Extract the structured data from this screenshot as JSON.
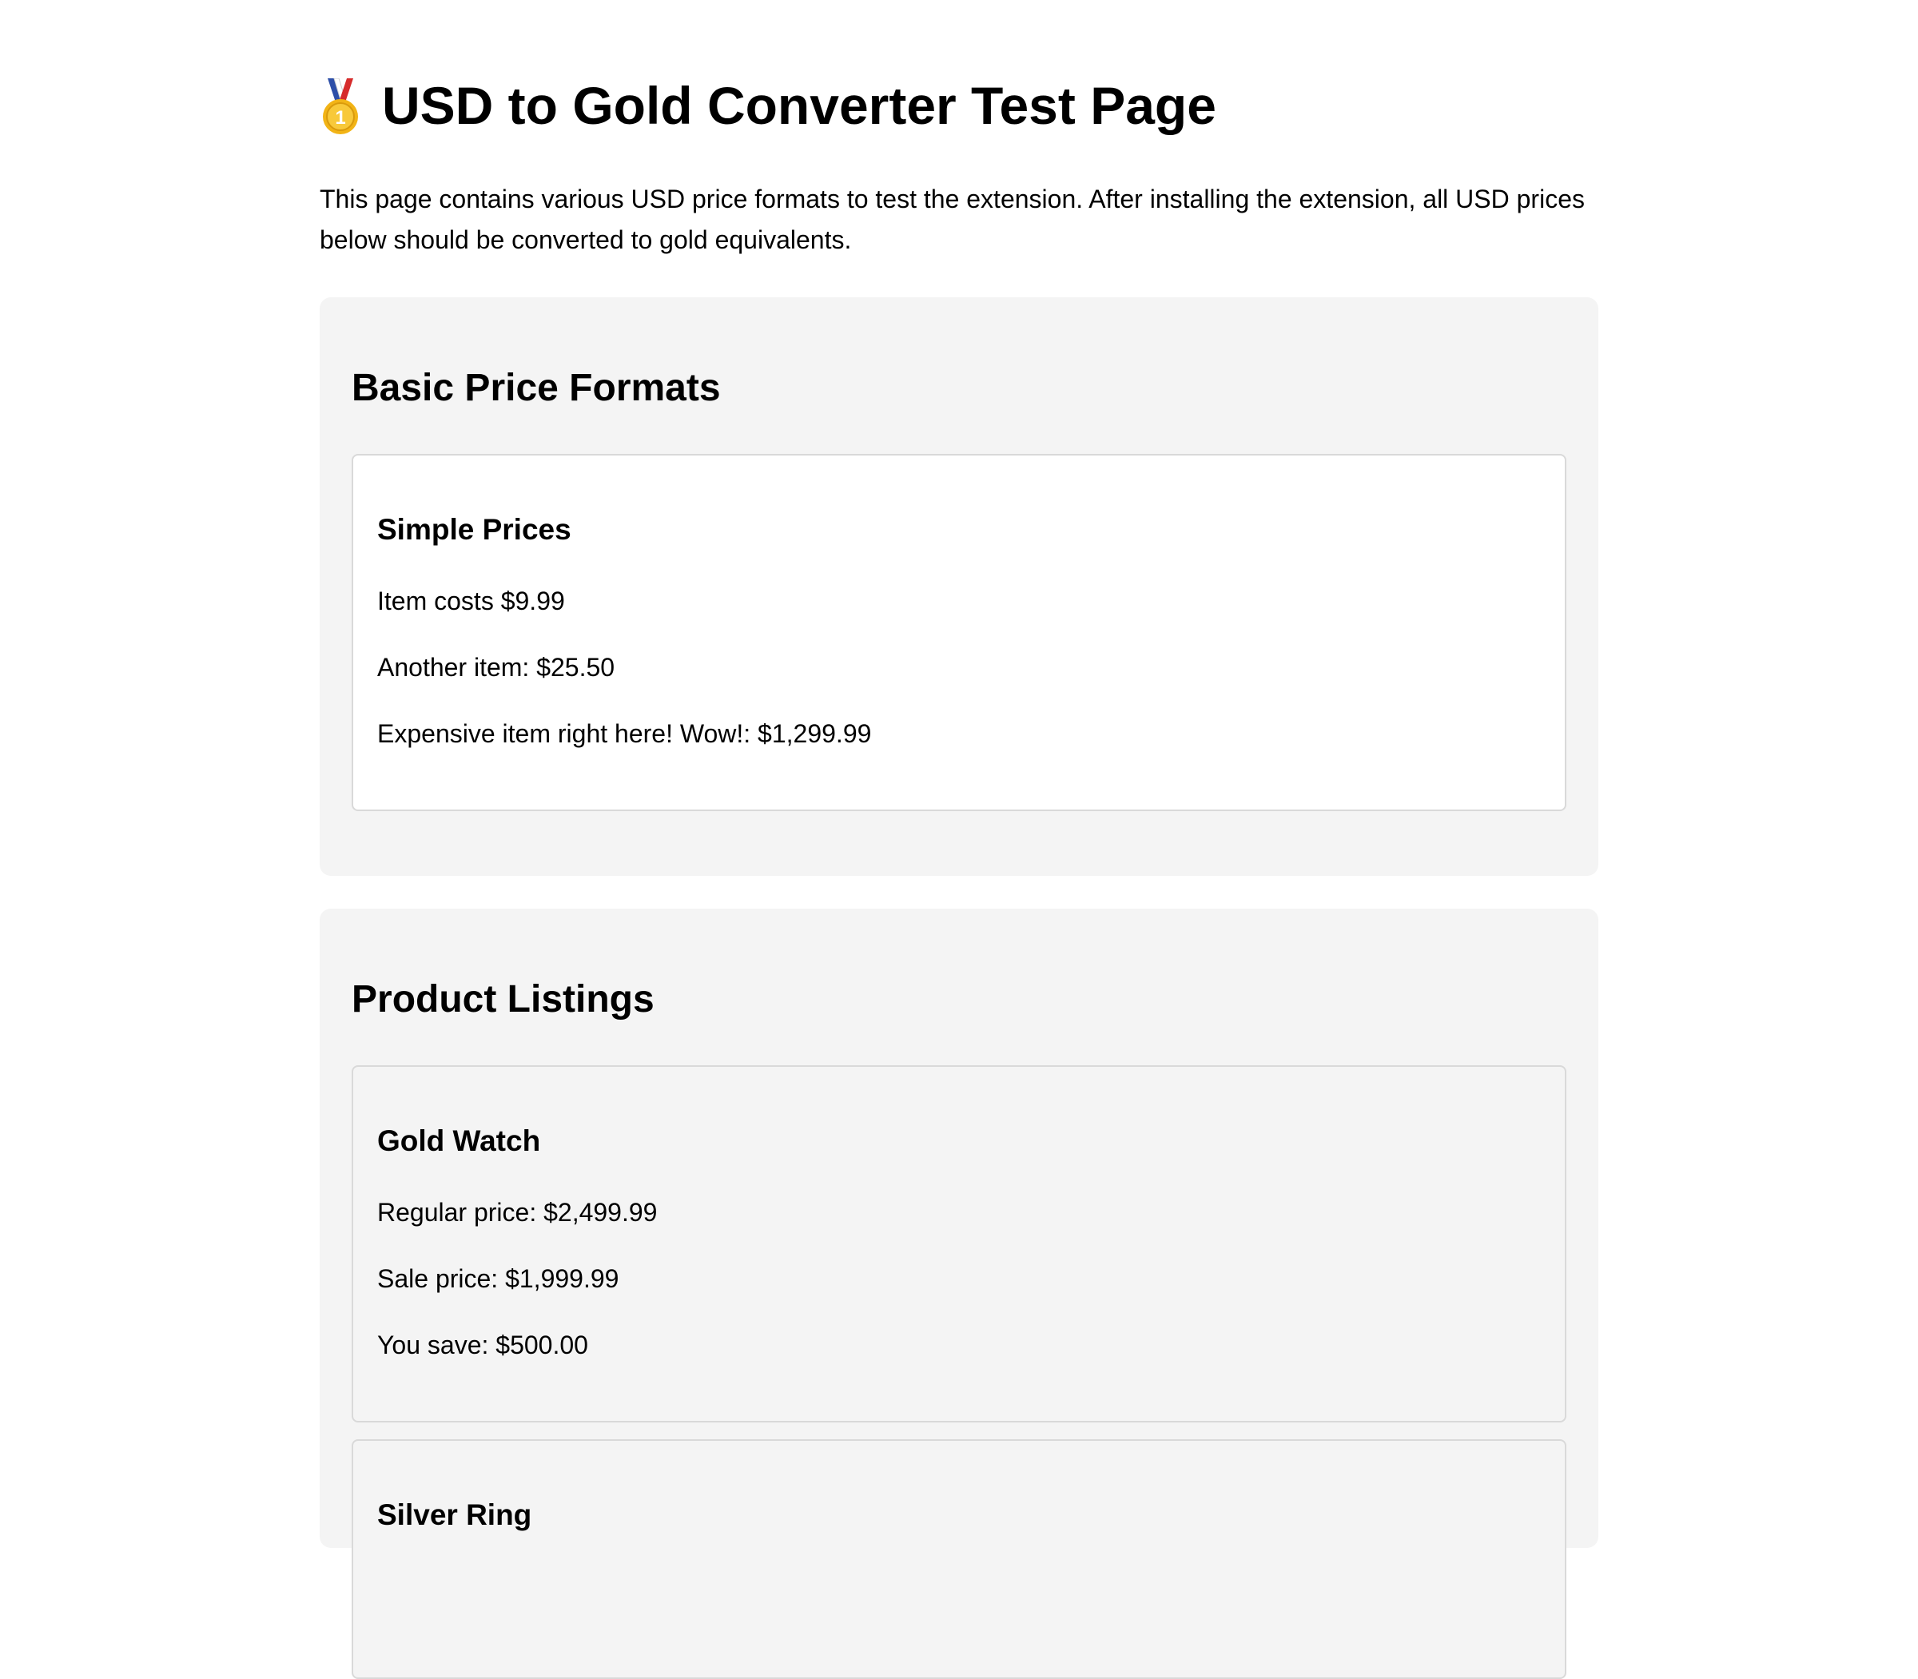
{
  "header": {
    "icon": "gold-medal-icon",
    "title": "USD to Gold Converter Test Page"
  },
  "intro": "This page contains various USD price formats to test the extension. After installing the extension, all USD prices below should be converted to gold equivalents.",
  "sections": [
    {
      "title": "Basic Price Formats",
      "cards": [
        {
          "title": "Simple Prices",
          "lines": [
            "Item costs $9.99",
            "Another item: $25.50",
            "Expensive item right here! Wow!: $1,299.99"
          ]
        }
      ]
    },
    {
      "title": "Product Listings",
      "cards": [
        {
          "title": "Gold Watch",
          "lines": [
            "Regular price: $2,499.99",
            "Sale price: $1,999.99",
            "You save: $500.00"
          ]
        },
        {
          "title": "Silver Ring",
          "lines": []
        }
      ]
    }
  ],
  "colors": {
    "section_bg": "#f4f4f4",
    "card_border": "#d9d9d9",
    "medal_gold": "#f2b416",
    "ribbon_blue": "#2d4fa8",
    "ribbon_red": "#d62b2b"
  }
}
